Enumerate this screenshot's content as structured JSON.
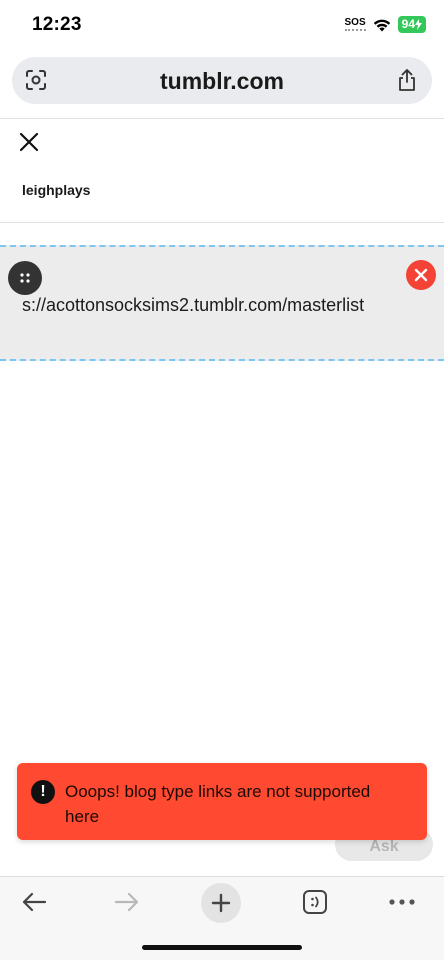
{
  "status": {
    "time": "12:23",
    "sos": "SOS",
    "battery": "94"
  },
  "browser": {
    "url": "tumblr.com"
  },
  "header": {
    "blog_name": "leighplays"
  },
  "link_block": {
    "url_text": "s://acottonsocksims2.tumblr.com/masterlist"
  },
  "toast": {
    "icon": "!",
    "message": "Ooops! blog type links are not supported here"
  },
  "ask_button": {
    "label": "Ask"
  },
  "colors": {
    "toast_bg": "#ff4930",
    "remove_btn": "#f44336",
    "link_border": "#7cc6f0",
    "battery": "#34c759"
  },
  "icons": {
    "address_left": "camera-scan-icon",
    "address_right": "share-icon",
    "close": "close-icon",
    "drag": "drag-handle-icon",
    "remove": "remove-icon",
    "toolbar": [
      "back-arrow-icon",
      "forward-arrow-icon",
      "new-tab-icon",
      "tabs-icon",
      "more-icon"
    ]
  }
}
